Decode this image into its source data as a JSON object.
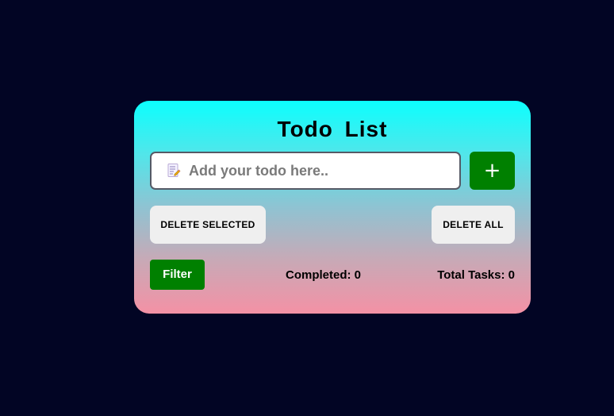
{
  "app": {
    "title": "Todo List"
  },
  "input": {
    "placeholder": "Add your todo here..",
    "value": "",
    "icon": "memo-icon"
  },
  "buttons": {
    "add_label": "+",
    "delete_selected_label": "DELETE SELECTED",
    "delete_all_label": "DELETE ALL",
    "filter_label": "Filter"
  },
  "stats": {
    "completed_text": "Completed: 0",
    "completed_count": 0,
    "total_text": "Total Tasks: 0",
    "total_count": 0
  },
  "colors": {
    "background": "#020524",
    "gradient_top": "#0cfffe",
    "gradient_bottom": "#f491a5",
    "accent_green": "#008000",
    "light_button": "#efefef"
  }
}
